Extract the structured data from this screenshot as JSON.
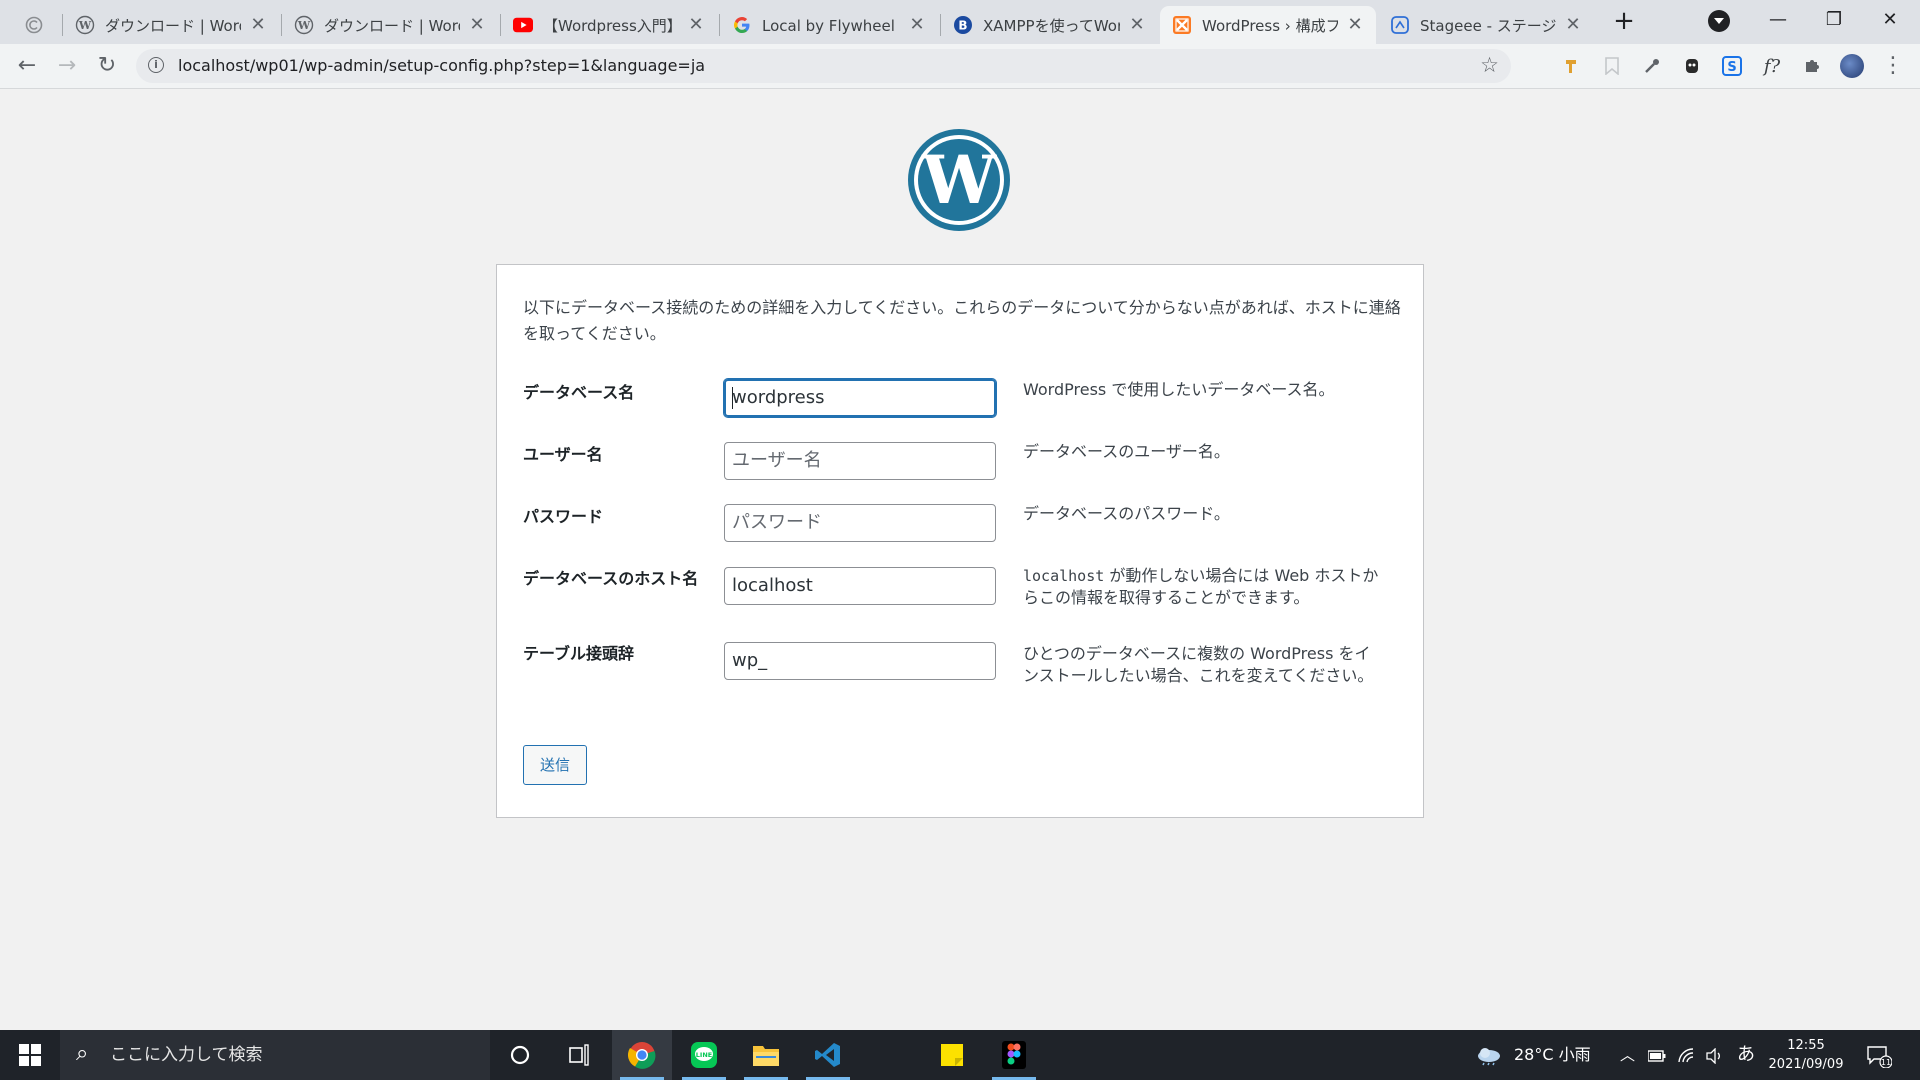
{
  "browser": {
    "tabs": [
      {
        "title": "",
        "icon": "loading-icon"
      },
      {
        "title": "ダウンロード | WordPress",
        "icon": "wordpress-icon"
      },
      {
        "title": "ダウンロード | WordPress",
        "icon": "wordpress-icon"
      },
      {
        "title": "【Wordpress入門】WEB",
        "icon": "youtube-icon"
      },
      {
        "title": "Local by Flywheel エラー",
        "icon": "google-icon"
      },
      {
        "title": "XAMPPを使ってWordPress",
        "icon": "b-icon"
      },
      {
        "title": "WordPress › 構成ファイル",
        "icon": "xampp-icon"
      },
      {
        "title": "Stageee - ステージー",
        "icon": "stageee-icon"
      }
    ],
    "active_tab": 6,
    "address_bar": "localhost/wp01/wp-admin/setup-config.php?step=1&language=ja"
  },
  "page": {
    "intro": "以下にデータベース接続のための詳細を入力してください。これらのデータについて分からない点があれば、ホストに連絡を取ってください。",
    "rows": [
      {
        "label": "データベース名",
        "value": "wordpress",
        "help": "WordPress で使用したいデータベース名。"
      },
      {
        "label": "ユーザー名",
        "value": "ユーザー名",
        "help": "データベースのユーザー名。"
      },
      {
        "label": "パスワード",
        "value": "パスワード",
        "help": "データベースのパスワード。"
      },
      {
        "label": "データベースのホスト名",
        "value": "localhost",
        "help_code": "localhost",
        "help": " が動作しない場合には Web ホストからこの情報を取得することができます。"
      },
      {
        "label": "テーブル接頭辞",
        "value": "wp_",
        "help": "ひとつのデータベースに複数の WordPress をインストールしたい場合、これを変えてください。"
      }
    ],
    "submit_label": "送信"
  },
  "taskbar": {
    "search_placeholder": "ここに入力して検索",
    "weather": "28°C 小雨",
    "ime": "あ",
    "time": "12:55",
    "date": "2021/09/09",
    "notifications": "11"
  },
  "colors": {
    "wp_blue": "#21759b",
    "accent": "#2271b1",
    "page_bg": "#f1f1f1"
  }
}
